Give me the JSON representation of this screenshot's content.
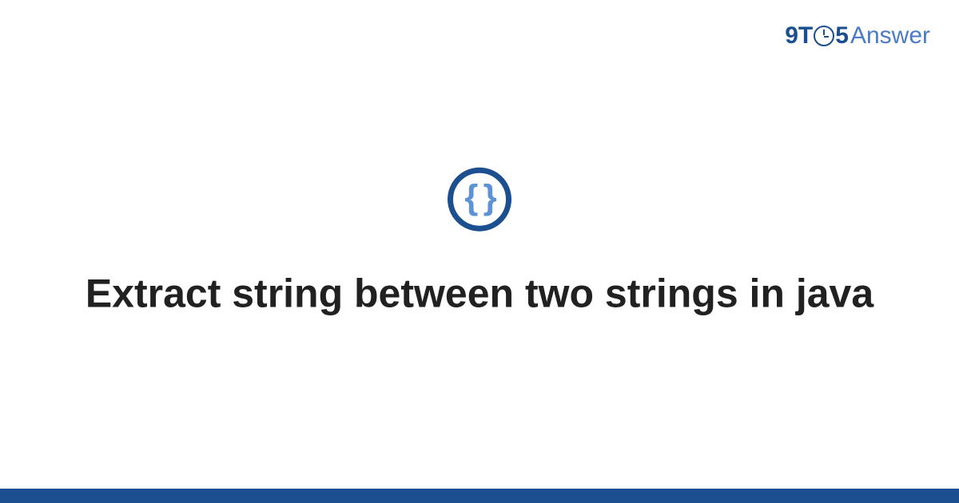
{
  "logo": {
    "part1": "9T",
    "part2": "5",
    "part3": "Answer"
  },
  "icon": {
    "braces": "{ }"
  },
  "title": "Extract string between two strings in java",
  "colors": {
    "primary": "#1b4f8f",
    "secondary": "#4a7bc4",
    "brace": "#5b93d4"
  }
}
